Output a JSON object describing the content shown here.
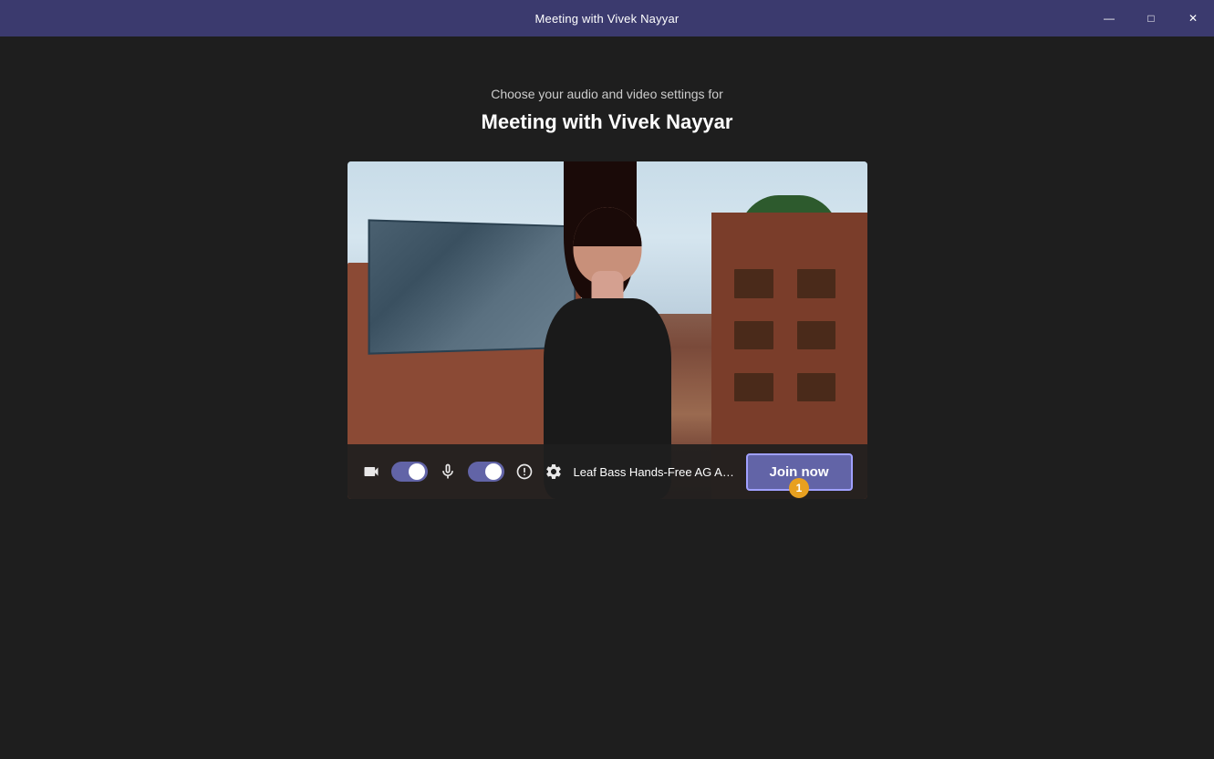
{
  "titlebar": {
    "title": "Meeting with Vivek Nayyar",
    "min_btn": "—",
    "max_btn": "□",
    "close_btn": "✕"
  },
  "header": {
    "subtitle": "Choose your audio and video settings for",
    "meeting_title": "Meeting with Vivek Nayyar"
  },
  "controls": {
    "audio_device_label": "Leaf Bass Hands-Free AG Au...",
    "join_now_label": "Join now",
    "notification_count": "1",
    "video_toggle_state": "on",
    "mic_toggle_state": "on"
  },
  "icons": {
    "camera": "📷",
    "mic": "🎤",
    "effects": "✦",
    "settings": "⚙"
  }
}
